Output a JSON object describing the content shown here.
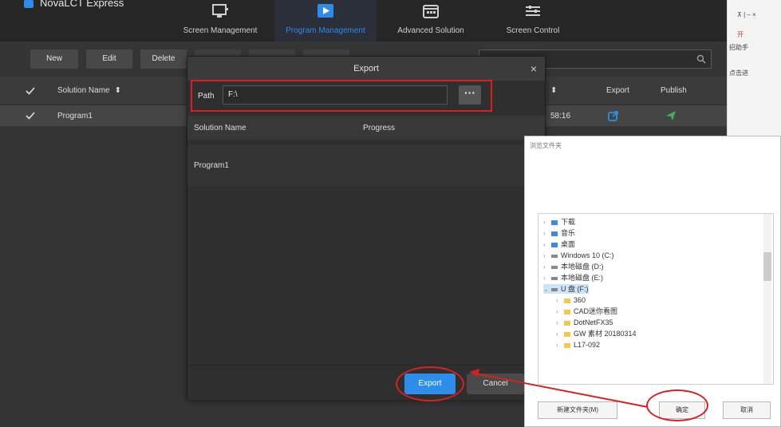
{
  "app": {
    "title": "NovaLCT Express"
  },
  "nav": [
    {
      "label": "Screen Management",
      "icon": "monitor-icon"
    },
    {
      "label": "Program Management",
      "icon": "play-icon",
      "active": true
    },
    {
      "label": "Advanced Solution",
      "icon": "calendar-icon"
    },
    {
      "label": "Screen Control",
      "icon": "sliders-icon"
    }
  ],
  "toolbar": {
    "new": "New",
    "edit": "Edit",
    "delete": "Delete"
  },
  "table": {
    "headers": [
      "Solution Name",
      "Export",
      "Publish"
    ],
    "row": {
      "name": "Program1",
      "time": "58:16"
    }
  },
  "export_dialog": {
    "title": "Export",
    "path_label": "Path",
    "path_value": "F:\\",
    "browse_label": "···",
    "col_solution": "Solution Name",
    "col_progress": "Progress",
    "row_name": "Program1",
    "export_btn": "Export",
    "cancel_btn": "Cancel"
  },
  "picker": {
    "title": "浏览文件夹",
    "tree": [
      {
        "label": "下载",
        "icon": "download-folder-icon",
        "depth": 0
      },
      {
        "label": "音乐",
        "icon": "music-folder-icon",
        "depth": 0
      },
      {
        "label": "桌面",
        "icon": "desktop-folder-icon",
        "depth": 0
      },
      {
        "label": "Windows 10 (C:)",
        "icon": "drive-icon",
        "depth": 0
      },
      {
        "label": "本地磁盘 (D:)",
        "icon": "drive-icon",
        "depth": 0
      },
      {
        "label": "本地磁盘 (E:)",
        "icon": "drive-icon",
        "depth": 0
      },
      {
        "label": "U 盘 (F:)",
        "icon": "usb-drive-icon",
        "depth": 0,
        "expanded": true
      },
      {
        "label": "360",
        "icon": "folder-icon",
        "depth": 1
      },
      {
        "label": "CAD迷你看图",
        "icon": "folder-icon",
        "depth": 1
      },
      {
        "label": "DotNetFX35",
        "icon": "folder-icon",
        "depth": 1
      },
      {
        "label": "GW 素材 20180314",
        "icon": "folder-icon",
        "depth": 1
      },
      {
        "label": "L17-092",
        "icon": "folder-icon",
        "depth": 1
      }
    ],
    "new_folder_btn": "新建文件夹(M)",
    "ok_btn": "确定",
    "cancel_btn": "取消"
  },
  "side": {
    "l1": "开",
    "l2": "招助手",
    "l3": "点击进"
  },
  "colors": {
    "accent": "#2e8de8",
    "annotation": "#d92020",
    "bg_dark": "#353535"
  }
}
